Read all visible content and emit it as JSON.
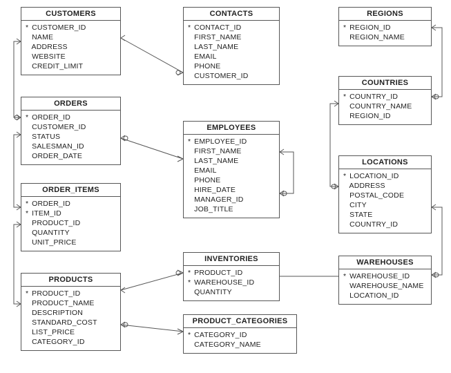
{
  "entities": {
    "customers": {
      "title": "CUSTOMERS",
      "fields": [
        {
          "name": "CUSTOMER_ID",
          "pk": true
        },
        {
          "name": "NAME",
          "pk": false
        },
        {
          "name": "ADDRESS",
          "pk": false
        },
        {
          "name": "WEBSITE",
          "pk": false
        },
        {
          "name": "CREDIT_LIMIT",
          "pk": false
        }
      ]
    },
    "contacts": {
      "title": "CONTACTS",
      "fields": [
        {
          "name": "CONTACT_ID",
          "pk": true
        },
        {
          "name": "FIRST_NAME",
          "pk": false
        },
        {
          "name": "LAST_NAME",
          "pk": false
        },
        {
          "name": "EMAIL",
          "pk": false
        },
        {
          "name": "PHONE",
          "pk": false
        },
        {
          "name": "CUSTOMER_ID",
          "pk": false
        }
      ]
    },
    "regions": {
      "title": "REGIONS",
      "fields": [
        {
          "name": "REGION_ID",
          "pk": true
        },
        {
          "name": "REGION_NAME",
          "pk": false
        }
      ]
    },
    "orders": {
      "title": "ORDERS",
      "fields": [
        {
          "name": "ORDER_ID",
          "pk": true
        },
        {
          "name": "CUSTOMER_ID",
          "pk": false
        },
        {
          "name": "STATUS",
          "pk": false
        },
        {
          "name": "SALESMAN_ID",
          "pk": false
        },
        {
          "name": "ORDER_DATE",
          "pk": false
        }
      ]
    },
    "employees": {
      "title": "EMPLOYEES",
      "fields": [
        {
          "name": "EMPLOYEE_ID",
          "pk": true
        },
        {
          "name": "FIRST_NAME",
          "pk": false
        },
        {
          "name": "LAST_NAME",
          "pk": false
        },
        {
          "name": "EMAIL",
          "pk": false
        },
        {
          "name": "PHONE",
          "pk": false
        },
        {
          "name": "HIRE_DATE",
          "pk": false
        },
        {
          "name": "MANAGER_ID",
          "pk": false
        },
        {
          "name": "JOB_TITLE",
          "pk": false
        }
      ]
    },
    "countries": {
      "title": "COUNTRIES",
      "fields": [
        {
          "name": "COUNTRY_ID",
          "pk": true
        },
        {
          "name": "COUNTRY_NAME",
          "pk": false
        },
        {
          "name": "REGION_ID",
          "pk": false
        }
      ]
    },
    "order_items": {
      "title": "ORDER_ITEMS",
      "fields": [
        {
          "name": "ORDER_ID",
          "pk": true
        },
        {
          "name": "ITEM_ID",
          "pk": true
        },
        {
          "name": "PRODUCT_ID",
          "pk": false
        },
        {
          "name": "QUANTITY",
          "pk": false
        },
        {
          "name": "UNIT_PRICE",
          "pk": false
        }
      ]
    },
    "locations": {
      "title": "LOCATIONS",
      "fields": [
        {
          "name": "LOCATION_ID",
          "pk": true
        },
        {
          "name": "ADDRESS",
          "pk": false
        },
        {
          "name": "POSTAL_CODE",
          "pk": false
        },
        {
          "name": "CITY",
          "pk": false
        },
        {
          "name": "STATE",
          "pk": false
        },
        {
          "name": "COUNTRY_ID",
          "pk": false
        }
      ]
    },
    "products": {
      "title": "PRODUCTS",
      "fields": [
        {
          "name": "PRODUCT_ID",
          "pk": true
        },
        {
          "name": "PRODUCT_NAME",
          "pk": false
        },
        {
          "name": "DESCRIPTION",
          "pk": false
        },
        {
          "name": "STANDARD_COST",
          "pk": false
        },
        {
          "name": "LIST_PRICE",
          "pk": false
        },
        {
          "name": "CATEGORY_ID",
          "pk": false
        }
      ]
    },
    "inventories": {
      "title": "INVENTORIES",
      "fields": [
        {
          "name": "PRODUCT_ID",
          "pk": true
        },
        {
          "name": "WAREHOUSE_ID",
          "pk": true
        },
        {
          "name": "QUANTITY",
          "pk": false
        }
      ]
    },
    "warehouses": {
      "title": "WAREHOUSES",
      "fields": [
        {
          "name": "WAREHOUSE_ID",
          "pk": true
        },
        {
          "name": "WAREHOUSE_NAME",
          "pk": false
        },
        {
          "name": "LOCATION_ID",
          "pk": false
        }
      ]
    },
    "product_categories": {
      "title": "PRODUCT_CATEGORIES",
      "fields": [
        {
          "name": "CATEGORY_ID",
          "pk": true
        },
        {
          "name": "CATEGORY_NAME",
          "pk": false
        }
      ]
    }
  },
  "relationships": [
    {
      "from": "customers",
      "to": "contacts"
    },
    {
      "from": "customers",
      "to": "orders"
    },
    {
      "from": "orders",
      "to": "employees"
    },
    {
      "from": "orders",
      "to": "order_items"
    },
    {
      "from": "order_items",
      "to": "products"
    },
    {
      "from": "products",
      "to": "inventories"
    },
    {
      "from": "products",
      "to": "product_categories"
    },
    {
      "from": "inventories",
      "to": "warehouses"
    },
    {
      "from": "warehouses",
      "to": "locations"
    },
    {
      "from": "locations",
      "to": "countries"
    },
    {
      "from": "countries",
      "to": "regions"
    },
    {
      "from": "employees",
      "to": "employees",
      "self": true
    }
  ]
}
